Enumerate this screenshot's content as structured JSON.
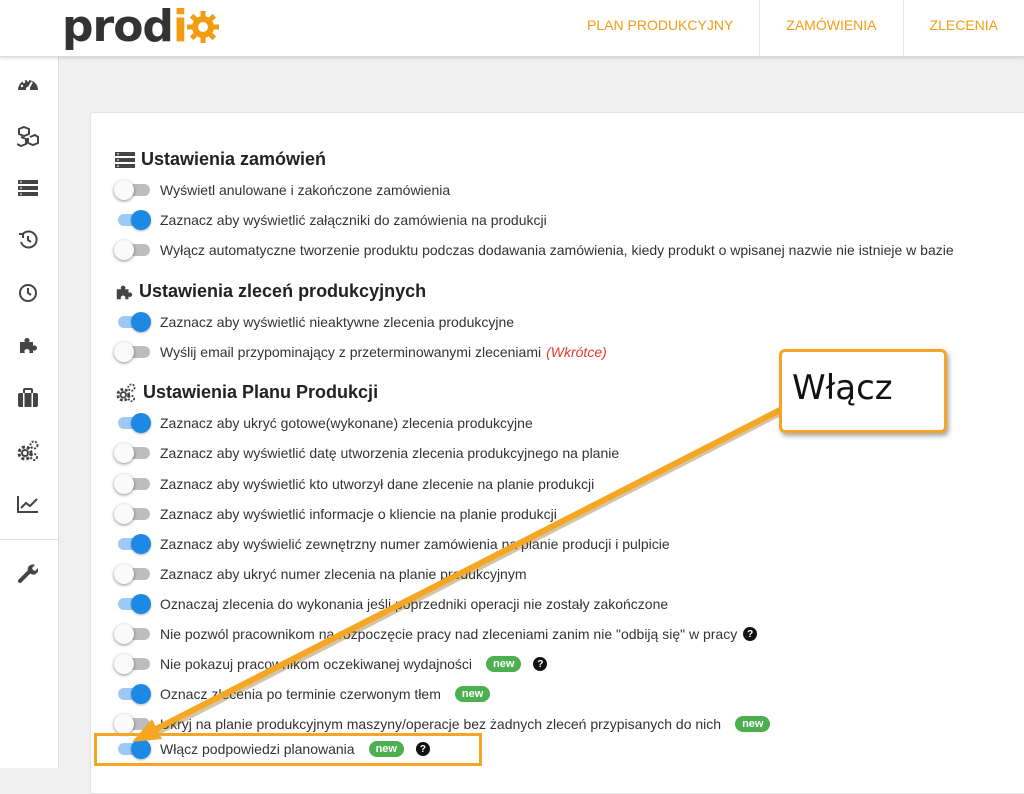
{
  "header": {
    "logo_text_dark": "prod",
    "logo_text_accent": "i",
    "nav": [
      "PLAN PRODUKCYJNY",
      "ZAMÓWIENIA",
      "ZLECENIA"
    ]
  },
  "sidebar": {
    "icons": [
      "dashboard-icon",
      "cubes-icon",
      "list-icon",
      "history-icon",
      "clock-icon",
      "puzzle-icon",
      "briefcase-icon",
      "cogs-icon",
      "chart-icon",
      "wrench-icon"
    ]
  },
  "sections": {
    "orders": {
      "title": "Ustawienia zamówień",
      "rows": [
        {
          "label": "Wyświetl anulowane i zakończone zamówienia",
          "on": false
        },
        {
          "label": "Zaznacz aby wyświetlić załączniki do zamówienia na produkcji",
          "on": true
        },
        {
          "label": "Wyłącz automatyczne tworzenie produktu podczas dodawania zamówienia, kiedy produkt o wpisanej nazwie nie istnieje w bazie",
          "on": false
        }
      ]
    },
    "production_orders": {
      "title": "Ustawienia zleceń produkcyjnych",
      "rows": [
        {
          "label": "Zaznacz aby wyświetlić nieaktywne zlecenia produkcyjne",
          "on": true
        },
        {
          "label": "Wyślij email przypominający z przeterminowanymi zleceniami",
          "note": "(Wkrótce)",
          "on": false
        }
      ]
    },
    "plan": {
      "title": "Ustawienia Planu Produkcji",
      "rows": [
        {
          "label": "Zaznacz aby ukryć gotowe(wykonane) zlecenia produkcyjne",
          "on": true
        },
        {
          "label": "Zaznacz aby wyświetlić datę utworzenia zlecenia produkcyjnego na planie",
          "on": false
        },
        {
          "label": "Zaznacz aby wyświetlić kto utworzył dane zlecenie na planie produkcji",
          "on": false
        },
        {
          "label": "Zaznacz aby wyświetlić informacje o kliencie na planie produkcji",
          "on": false
        },
        {
          "label": "Zaznacz aby wyświelić zewnętrzny numer zamówienia na planie producji i pulpicie",
          "on": true
        },
        {
          "label": "Zaznacz aby ukryć numer zlecenia na planie produkcyjnym",
          "on": false
        },
        {
          "label": "Oznaczaj zlecenia do wykonania jeśli poprzedniki operacji nie zostały zakończone",
          "on": true
        },
        {
          "label": "Nie pozwól pracownikom na rozpoczęcie pracy nad zleceniami zanim nie \"odbiją się\" w pracy",
          "on": false,
          "help": true
        },
        {
          "label": "Nie pokazuj pracownikom oczekiwanej wydajności",
          "on": false,
          "badge": "new",
          "help": true
        },
        {
          "label": "Oznacz zlecenia po terminie czerwonym tłem",
          "on": true,
          "badge": "new"
        },
        {
          "label": "Ukryj na planie produkcyjnym maszyny/operacje bez żadnych zleceń przypisanych do nich",
          "on": false,
          "badge": "new"
        },
        {
          "label": "Włącz podpowiedzi planowania",
          "on": true,
          "badge": "new",
          "help": true
        }
      ]
    }
  },
  "annotation": {
    "callout_text": "Włącz"
  },
  "colors": {
    "accent": "#f39c12",
    "toggle_on": "#1e88e5",
    "badge": "#4caf50",
    "annotation": "#f5a623"
  }
}
